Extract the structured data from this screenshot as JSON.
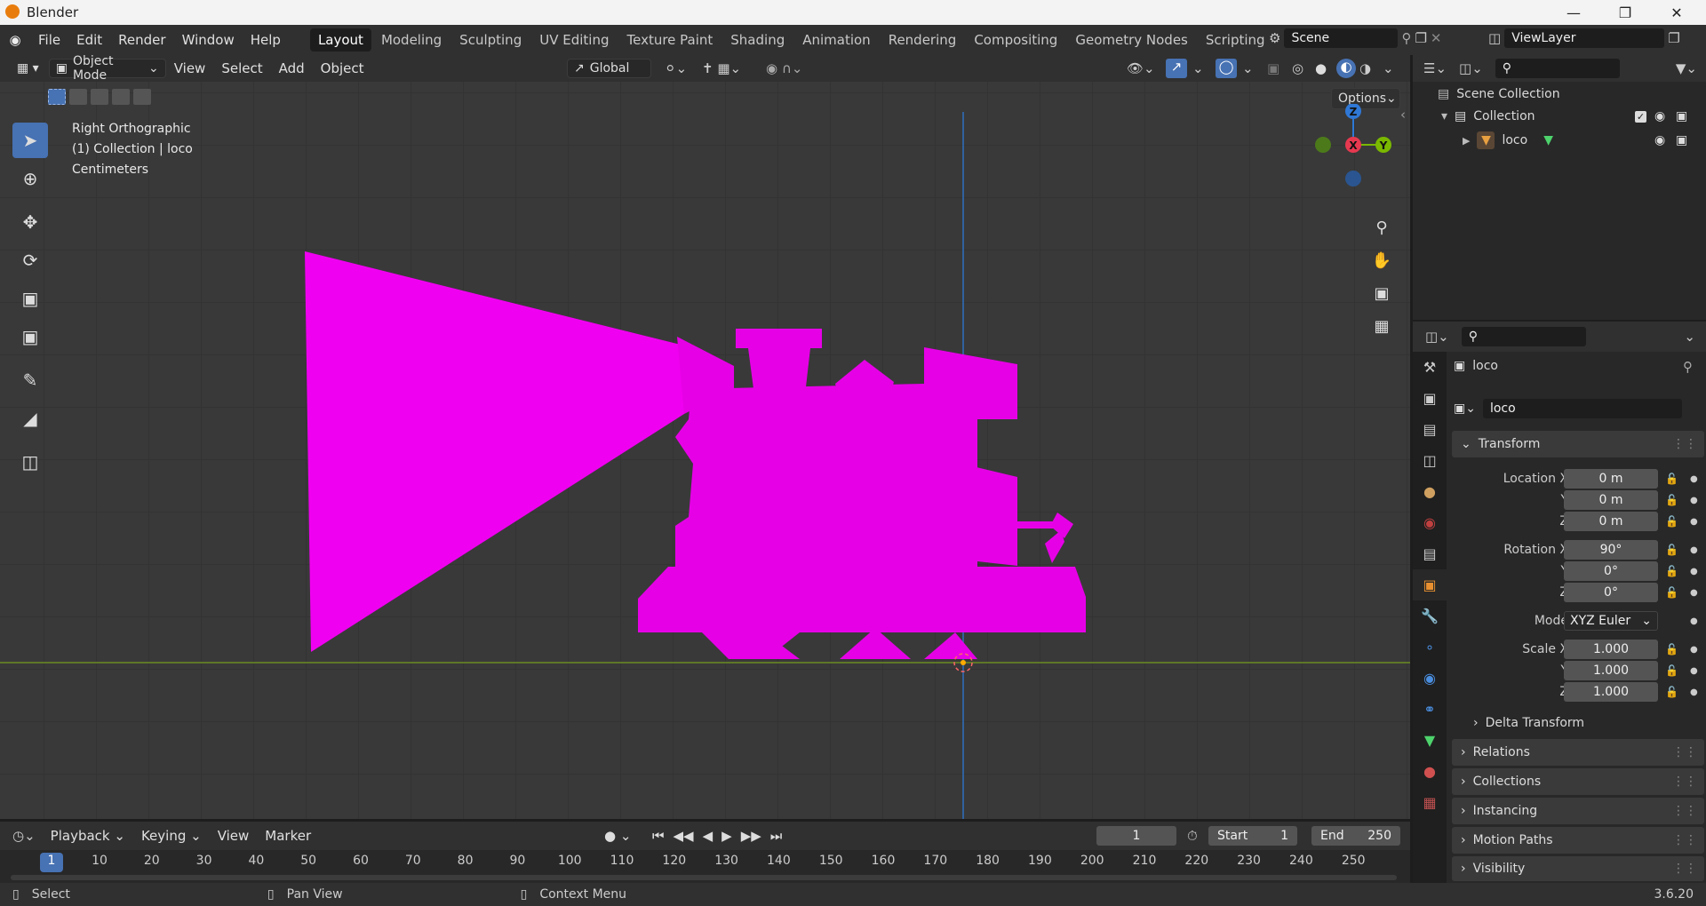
{
  "app": {
    "title": "Blender",
    "version": "3.6.20"
  },
  "menu": [
    "File",
    "Edit",
    "Render",
    "Window",
    "Help"
  ],
  "workspaces": [
    "Layout",
    "Modeling",
    "Sculpting",
    "UV Editing",
    "Texture Paint",
    "Shading",
    "Animation",
    "Rendering",
    "Compositing",
    "Geometry Nodes",
    "Scripting"
  ],
  "active_workspace": "Layout",
  "scene": {
    "name": "Scene",
    "view_layer": "ViewLayer"
  },
  "viewport_header": {
    "mode": "Object Mode",
    "menus": [
      "View",
      "Select",
      "Add",
      "Object"
    ],
    "orientation": "Global",
    "options": "Options"
  },
  "viewport_info": {
    "view": "Right Orthographic",
    "collection": "(1) Collection | loco",
    "units": "Centimeters"
  },
  "gizmo_axes": {
    "z": "Z",
    "x": "X",
    "y": "Y"
  },
  "outliner": {
    "scene_collection": "Scene Collection",
    "collection": "Collection",
    "object": "loco"
  },
  "properties": {
    "object_name": "loco",
    "data_name": "loco",
    "transform_title": "Transform",
    "location": {
      "label_x": "Location X",
      "x": "0 m",
      "y": "0 m",
      "z": "0 m"
    },
    "rotation": {
      "label_x": "Rotation X",
      "x": "90°",
      "y": "0°",
      "z": "0°"
    },
    "mode_label": "Mode",
    "mode": "XYZ Euler",
    "scale": {
      "label_x": "Scale X",
      "x": "1.000",
      "y": "1.000",
      "z": "1.000"
    },
    "axis_y": "Y",
    "axis_z": "Z",
    "panels": [
      "Delta Transform",
      "Relations",
      "Collections",
      "Instancing",
      "Motion Paths",
      "Visibility"
    ]
  },
  "timeline": {
    "menus": [
      "Playback",
      "Keying",
      "View",
      "Marker"
    ],
    "current_frame": "1",
    "start_label": "Start",
    "start": "1",
    "end_label": "End",
    "end": "250",
    "ticks": [
      "1",
      "10",
      "20",
      "30",
      "40",
      "50",
      "60",
      "70",
      "80",
      "90",
      "100",
      "110",
      "120",
      "130",
      "140",
      "150",
      "160",
      "170",
      "180",
      "190",
      "200",
      "210",
      "220",
      "230",
      "240",
      "250"
    ]
  },
  "statusbar": {
    "select": "Select",
    "pan": "Pan View",
    "context": "Context Menu"
  },
  "colors": {
    "accent": "#4772b3",
    "mesh": "#e600e6",
    "axis_x": "#ff3352",
    "axis_y": "#8bdc00",
    "axis_z": "#2890ff"
  }
}
